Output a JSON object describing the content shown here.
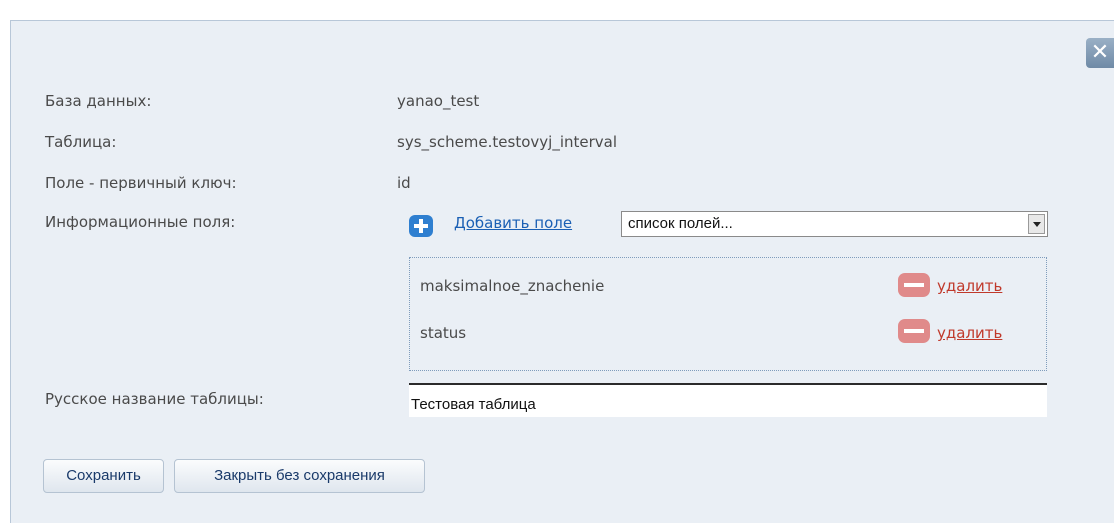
{
  "close_symbol": "✕",
  "rows": {
    "database": {
      "label": "База данных:",
      "value": "yanao_test"
    },
    "table": {
      "label": "Таблица:",
      "value": "sys_scheme.testovyj_interval"
    },
    "primary_key": {
      "label": "Поле - первичный ключ:",
      "value": "id"
    },
    "info_fields": {
      "label": "Информационные поля:"
    }
  },
  "add_field": {
    "link": "Добавить поле",
    "icon": "plus-icon"
  },
  "fields_select": {
    "selected": "список полей..."
  },
  "fields": [
    {
      "name": "maksimalnoe_znachenie",
      "remove_label": "удалить"
    },
    {
      "name": "status",
      "remove_label": "удалить"
    }
  ],
  "russian_name": {
    "label": "Русское название таблицы:",
    "value": "Тестовая таблица"
  },
  "buttons": {
    "save": "Сохранить",
    "close_no_save": "Закрыть без сохранения"
  },
  "colors": {
    "background": "#eaeff5",
    "link": "#1a5fb4",
    "remove": "#c0392b",
    "remove_icon": "#e08a8a",
    "add_icon": "#2f7fd0"
  }
}
